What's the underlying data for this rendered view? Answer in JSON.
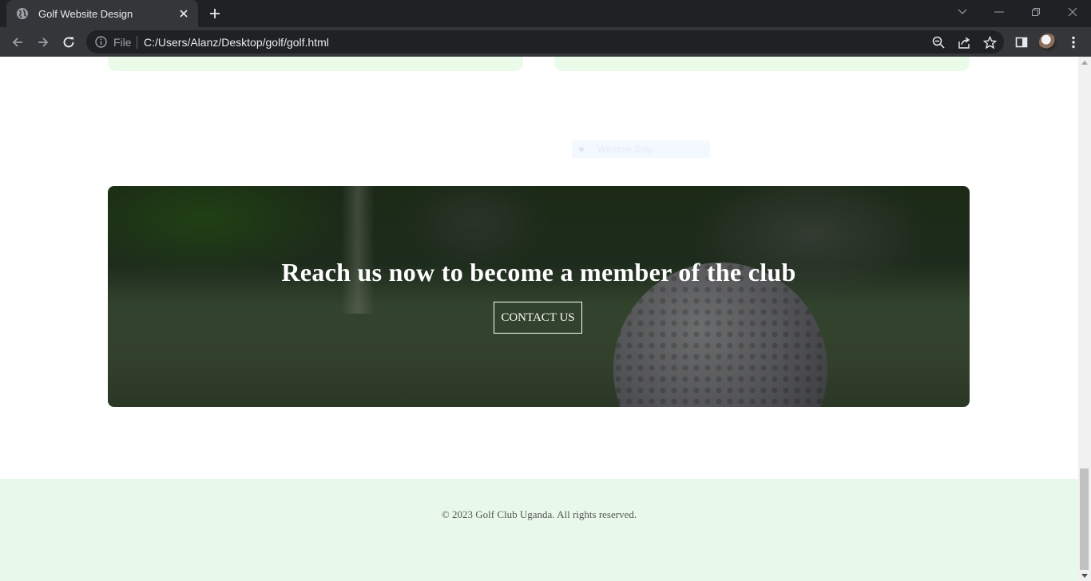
{
  "browser": {
    "tab_title": "Golf Website Design",
    "omnibox": {
      "scheme_label": "File",
      "url": "C:/Users/Alanz/Desktop/golf/golf.html"
    }
  },
  "page": {
    "overlay_snip_label": "Window Snip",
    "cta": {
      "heading": "Reach us now to become a member of the club",
      "button_label": "CONTACT US"
    },
    "footer": {
      "copyright": "© 2023 Golf Club Uganda. All rights reserved."
    }
  },
  "colors": {
    "chrome_dark": "#202124",
    "chrome_tab": "#35363a",
    "card_mint": "#eafbea",
    "footer_mint": "#e8f9ea"
  },
  "icons": [
    "globe-icon",
    "close-icon",
    "plus-icon",
    "chevron-down-icon",
    "minimize-icon",
    "restore-icon",
    "back-icon",
    "forward-icon",
    "reload-icon",
    "info-icon",
    "zoom-icon",
    "share-icon",
    "star-icon",
    "side-panel-icon",
    "kebab-menu-icon"
  ]
}
